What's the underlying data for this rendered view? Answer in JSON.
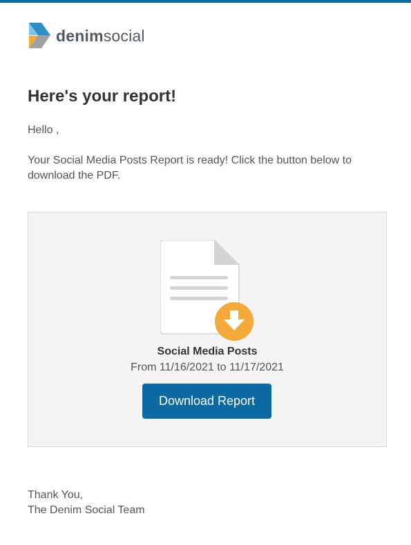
{
  "brand": {
    "name_bold": "denim",
    "name_light": "social",
    "colors": {
      "top_bar": "#0a6aa1",
      "logo_blue": "#2b90c9",
      "logo_light_blue": "#7cc4ea",
      "logo_orange": "#f6a93b",
      "logo_grey": "#9aa2a8",
      "button": "#0a6aa1",
      "download_badge": "#f6a93b"
    }
  },
  "email": {
    "heading": "Here's your report!",
    "greeting": "Hello ,",
    "intro": "Your Social Media Posts Report is ready! Click the button below to download the PDF.",
    "report": {
      "icon": "document-download-icon",
      "title": "Social Media Posts",
      "date_range": "From 11/16/2021 to 11/17/2021",
      "button_label": "Download Report"
    },
    "signoff": {
      "line1": "Thank You,",
      "line2": "The Denim Social Team"
    }
  }
}
